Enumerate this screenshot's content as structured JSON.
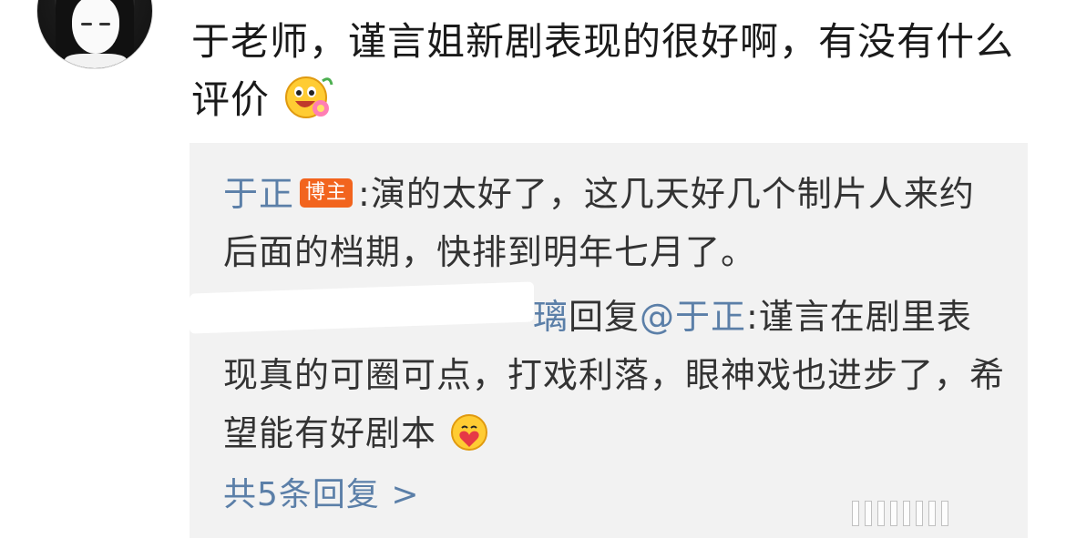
{
  "avatar": {
    "label": ""
  },
  "comment": {
    "text": "于老师，谨言姐新剧表现的很好啊，有没有什么评价",
    "emoji": "smile-flower-emoji"
  },
  "replies": [
    {
      "author": "于正",
      "badge": "博主",
      "colon": ":",
      "text": "演的太好了，这几天好几个制片人来约后面的档期，快排到明年七月了。"
    },
    {
      "author": "",
      "suffix": "璃",
      "action": "回复",
      "mention": "@于正",
      "text": ":谨言在剧里表现真的可圈可点，打戏利落，眼神戏也进步了，希望能有好剧本",
      "emoji": "hug-heart-emoji"
    }
  ],
  "more_replies": "共5条回复 >",
  "colors": {
    "link": "#5b7fa8",
    "badge": "#f2641e",
    "reply_bg": "#f2f2f2"
  }
}
